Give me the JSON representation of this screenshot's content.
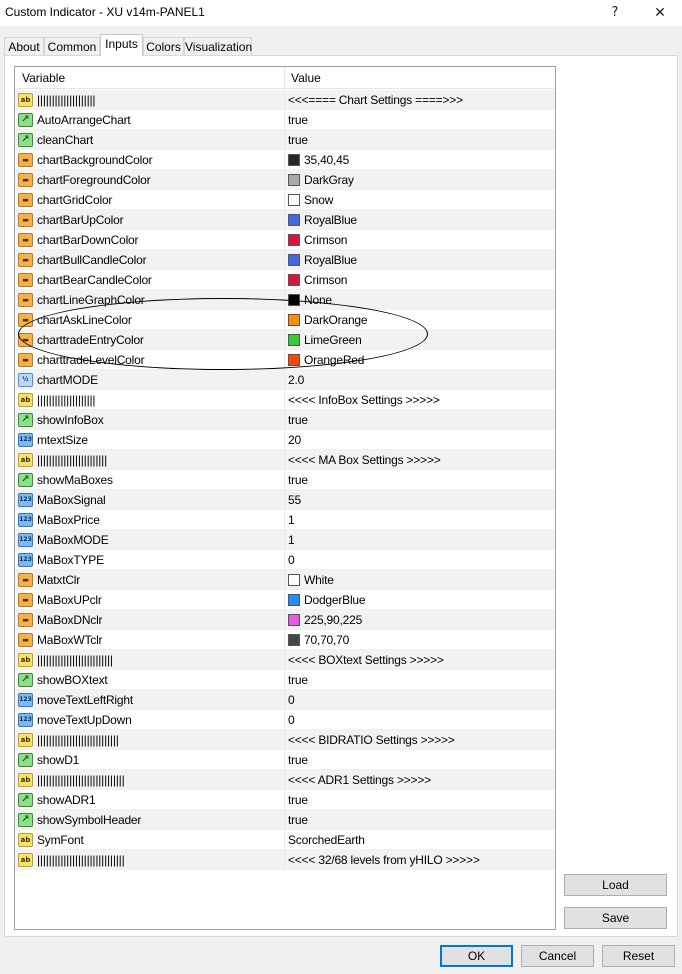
{
  "window": {
    "title": "Custom Indicator - XU v14m-PANEL1",
    "help_glyph": "?",
    "close_glyph": "✕"
  },
  "tabs": [
    "About",
    "Common",
    "Inputs",
    "Colors",
    "Visualization"
  ],
  "active_tab": "Inputs",
  "table": {
    "headers": {
      "variable": "Variable",
      "value": "Value"
    },
    "rows": [
      {
        "type": "ab",
        "icon_text": "ab",
        "name": "||||||||||||||||||||",
        "value": "<<<==== Chart Settings ====>>>"
      },
      {
        "type": "bool",
        "icon_text": "↗",
        "name": "AutoArrangeChart",
        "value": "true"
      },
      {
        "type": "bool",
        "icon_text": "↗",
        "name": "cleanChart",
        "value": "true"
      },
      {
        "type": "color",
        "icon_text": "▬",
        "name": "chartBackgroundColor",
        "value": "35,40,45",
        "swatch": "#23282d"
      },
      {
        "type": "color",
        "icon_text": "▬",
        "name": "chartForegroundColor",
        "value": "DarkGray",
        "swatch": "#a9a9a9"
      },
      {
        "type": "color",
        "icon_text": "▬",
        "name": "chartGridColor",
        "value": "Snow",
        "swatch": "#fffafa"
      },
      {
        "type": "color",
        "icon_text": "▬",
        "name": "chartBarUpColor",
        "value": "RoyalBlue",
        "swatch": "#4169e1"
      },
      {
        "type": "color",
        "icon_text": "▬",
        "name": "chartBarDownColor",
        "value": "Crimson",
        "swatch": "#dc143c"
      },
      {
        "type": "color",
        "icon_text": "▬",
        "name": "chartBullCandleColor",
        "value": "RoyalBlue",
        "swatch": "#4169e1"
      },
      {
        "type": "color",
        "icon_text": "▬",
        "name": "chartBearCandleColor",
        "value": "Crimson",
        "swatch": "#dc143c"
      },
      {
        "type": "color",
        "icon_text": "▬",
        "name": "chartLineGraphColor",
        "value": "None",
        "swatch": "#000000"
      },
      {
        "type": "color",
        "icon_text": "▬",
        "name": "chartAskLineColor",
        "value": "DarkOrange",
        "swatch": "#ff8c00"
      },
      {
        "type": "color",
        "icon_text": "▬",
        "name": "charttradeEntryColor",
        "value": "LimeGreen",
        "swatch": "#32cd32"
      },
      {
        "type": "color",
        "icon_text": "▬",
        "name": "charttradeLevelColor",
        "value": "OrangeRed",
        "swatch": "#ff4500"
      },
      {
        "type": "float",
        "icon_text": "½",
        "name": "chartMODE",
        "value": "2.0"
      },
      {
        "type": "ab",
        "icon_text": "ab",
        "name": "||||||||||||||||||||",
        "value": "<<<< InfoBox Settings >>>>>"
      },
      {
        "type": "bool",
        "icon_text": "↗",
        "name": "showInfoBox",
        "value": "true"
      },
      {
        "type": "num",
        "icon_text": "123",
        "name": "mtextSize",
        "value": "20"
      },
      {
        "type": "ab",
        "icon_text": "ab",
        "name": "||||||||||||||||||||||||",
        "value": "<<<< MA Box Settings >>>>>"
      },
      {
        "type": "bool",
        "icon_text": "↗",
        "name": "showMaBoxes",
        "value": "true"
      },
      {
        "type": "num",
        "icon_text": "123",
        "name": "MaBoxSignal",
        "value": "55"
      },
      {
        "type": "num",
        "icon_text": "123",
        "name": "MaBoxPrice",
        "value": "1"
      },
      {
        "type": "num",
        "icon_text": "123",
        "name": "MaBoxMODE",
        "value": "1"
      },
      {
        "type": "num",
        "icon_text": "123",
        "name": "MaBoxTYPE",
        "value": "0"
      },
      {
        "type": "color",
        "icon_text": "▬",
        "name": "MatxtClr",
        "value": "White",
        "swatch": "#ffffff"
      },
      {
        "type": "color",
        "icon_text": "▬",
        "name": "MaBoxUPclr",
        "value": "DodgerBlue",
        "swatch": "#1e90ff"
      },
      {
        "type": "color",
        "icon_text": "▬",
        "name": "MaBoxDNclr",
        "value": "225,90,225",
        "swatch": "#e15ae1"
      },
      {
        "type": "color",
        "icon_text": "▬",
        "name": "MaBoxWTclr",
        "value": "70,70,70",
        "swatch": "#464646"
      },
      {
        "type": "ab",
        "icon_text": "ab",
        "name": "||||||||||||||||||||||||||",
        "value": "<<<< BOXtext Settings >>>>>"
      },
      {
        "type": "bool",
        "icon_text": "↗",
        "name": "showBOXtext",
        "value": "true"
      },
      {
        "type": "num",
        "icon_text": "123",
        "name": "moveTextLeftRight",
        "value": "0"
      },
      {
        "type": "num",
        "icon_text": "123",
        "name": "moveTextUpDown",
        "value": "0"
      },
      {
        "type": "ab",
        "icon_text": "ab",
        "name": "||||||||||||||||||||||||||||",
        "value": "<<<< BIDRATIO Settings >>>>>"
      },
      {
        "type": "bool",
        "icon_text": "↗",
        "name": "showD1",
        "value": "true"
      },
      {
        "type": "ab",
        "icon_text": "ab",
        "name": "||||||||||||||||||||||||||||||",
        "value": "<<<< ADR1 Settings >>>>>"
      },
      {
        "type": "bool",
        "icon_text": "↗",
        "name": "showADR1",
        "value": "true"
      },
      {
        "type": "bool",
        "icon_text": "↗",
        "name": "showSymbolHeader",
        "value": "true"
      },
      {
        "type": "ab",
        "icon_text": "ab",
        "name": "SymFont",
        "value": "ScorchedEarth"
      },
      {
        "type": "ab",
        "icon_text": "ab",
        "name": "||||||||||||||||||||||||||||||",
        "value": "<<<< 32/68 levels from yHILO >>>>>"
      }
    ]
  },
  "buttons": {
    "load": "Load",
    "save": "Save",
    "ok": "OK",
    "cancel": "Cancel",
    "reset": "Reset"
  }
}
